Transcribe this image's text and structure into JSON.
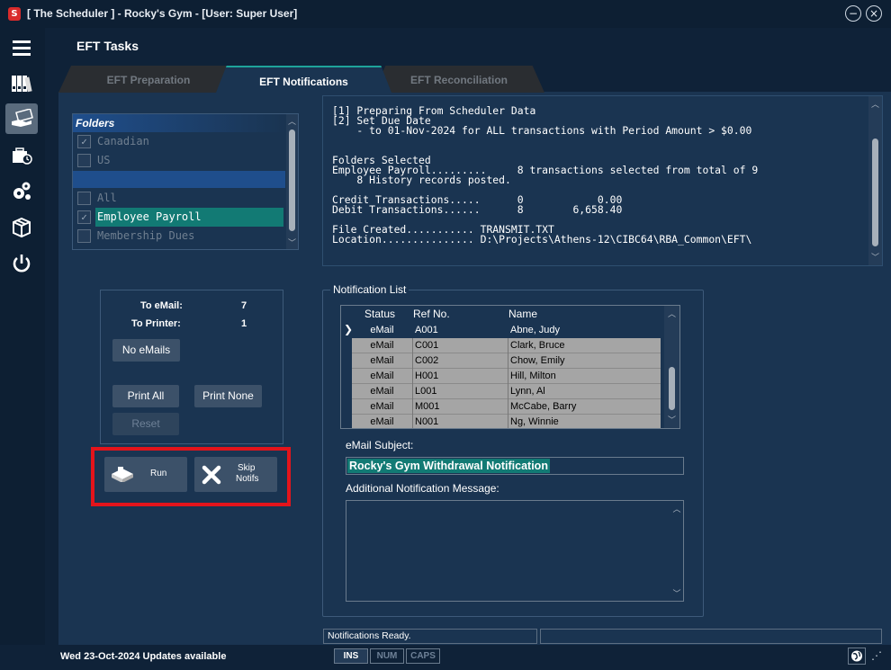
{
  "window": {
    "title": "[ The Scheduler ] - Rocky's Gym - [User: Super User]",
    "app_icon": "S",
    "minimize": "−",
    "close": "×"
  },
  "sidebar": {
    "icons": [
      "hamburger-menu-icon",
      "binders-icon",
      "payment-hand-icon",
      "briefcase-clock-icon",
      "gears-icon",
      "box-icon",
      "power-icon"
    ]
  },
  "page": {
    "title": "EFT Tasks"
  },
  "tabs": [
    {
      "label": "EFT Preparation",
      "active": false
    },
    {
      "label": "EFT Notifications",
      "active": true
    },
    {
      "label": "EFT Reconciliation",
      "active": false
    }
  ],
  "folders": {
    "header": "Folders",
    "items": [
      {
        "label": "Canadian",
        "checked": true,
        "style": "disabled"
      },
      {
        "label": "US",
        "checked": false,
        "style": "disabled"
      },
      {
        "label": "",
        "checked": null,
        "style": "separator"
      },
      {
        "label": "All",
        "checked": false,
        "style": "disabled"
      },
      {
        "label": "Employee Payroll",
        "checked": true,
        "style": "selected"
      },
      {
        "label": "Membership Dues",
        "checked": false,
        "style": "disabled"
      }
    ]
  },
  "log": {
    "lines": [
      "[1] Preparing From Scheduler Data",
      "[2] Set Due Date",
      "    - to 01-Nov-2024 for ALL transactions with Period Amount > $0.00",
      "",
      "",
      "Folders Selected",
      "Employee Payroll.........     8 transactions selected from total of 9",
      "    8 History records posted.",
      "",
      "Credit Transactions.....      0            0.00",
      "Debit Transactions......      8        6,658.40",
      "",
      "File Created........... TRANSMIT.TXT",
      "Location............... D:\\Projects\\Athens-12\\CIBC64\\RBA_Common\\EFT\\"
    ]
  },
  "counts": {
    "to_email_label": "To eMail:",
    "to_email_value": "7",
    "to_printer_label": "To Printer:",
    "to_printer_value": "1",
    "no_emails": "No eMails",
    "print_all": "Print All",
    "print_none": "Print None",
    "reset": "Reset"
  },
  "actions": {
    "run": "Run",
    "skip_line1": "Skip",
    "skip_line2": "Notifs"
  },
  "notification_list": {
    "caption": "Notification List",
    "columns": [
      "Status",
      "Ref No.",
      "Name"
    ],
    "rows": [
      {
        "status": "eMail",
        "ref": "A001",
        "name": "Abne, Judy"
      },
      {
        "status": "eMail",
        "ref": "C001",
        "name": "Clark, Bruce"
      },
      {
        "status": "eMail",
        "ref": "C002",
        "name": "Chow, Emily"
      },
      {
        "status": "eMail",
        "ref": "H001",
        "name": "Hill, Milton"
      },
      {
        "status": "eMail",
        "ref": "L001",
        "name": "Lynn, Al"
      },
      {
        "status": "eMail",
        "ref": "M001",
        "name": "McCabe, Barry"
      },
      {
        "status": "eMail",
        "ref": "N001",
        "name": "Ng, Winnie"
      }
    ]
  },
  "email": {
    "subject_label": "eMail Subject:",
    "subject_value": "Rocky's Gym Withdrawal Notification",
    "message_label": "Additional Notification Message:",
    "message_value": ""
  },
  "status": {
    "message": "Notifications Ready.",
    "date": "Wed  23-Oct-2024  Updates available",
    "keys": [
      {
        "label": "INS",
        "on": true
      },
      {
        "label": "NUM",
        "on": false
      },
      {
        "label": "CAPS",
        "on": false
      }
    ]
  }
}
